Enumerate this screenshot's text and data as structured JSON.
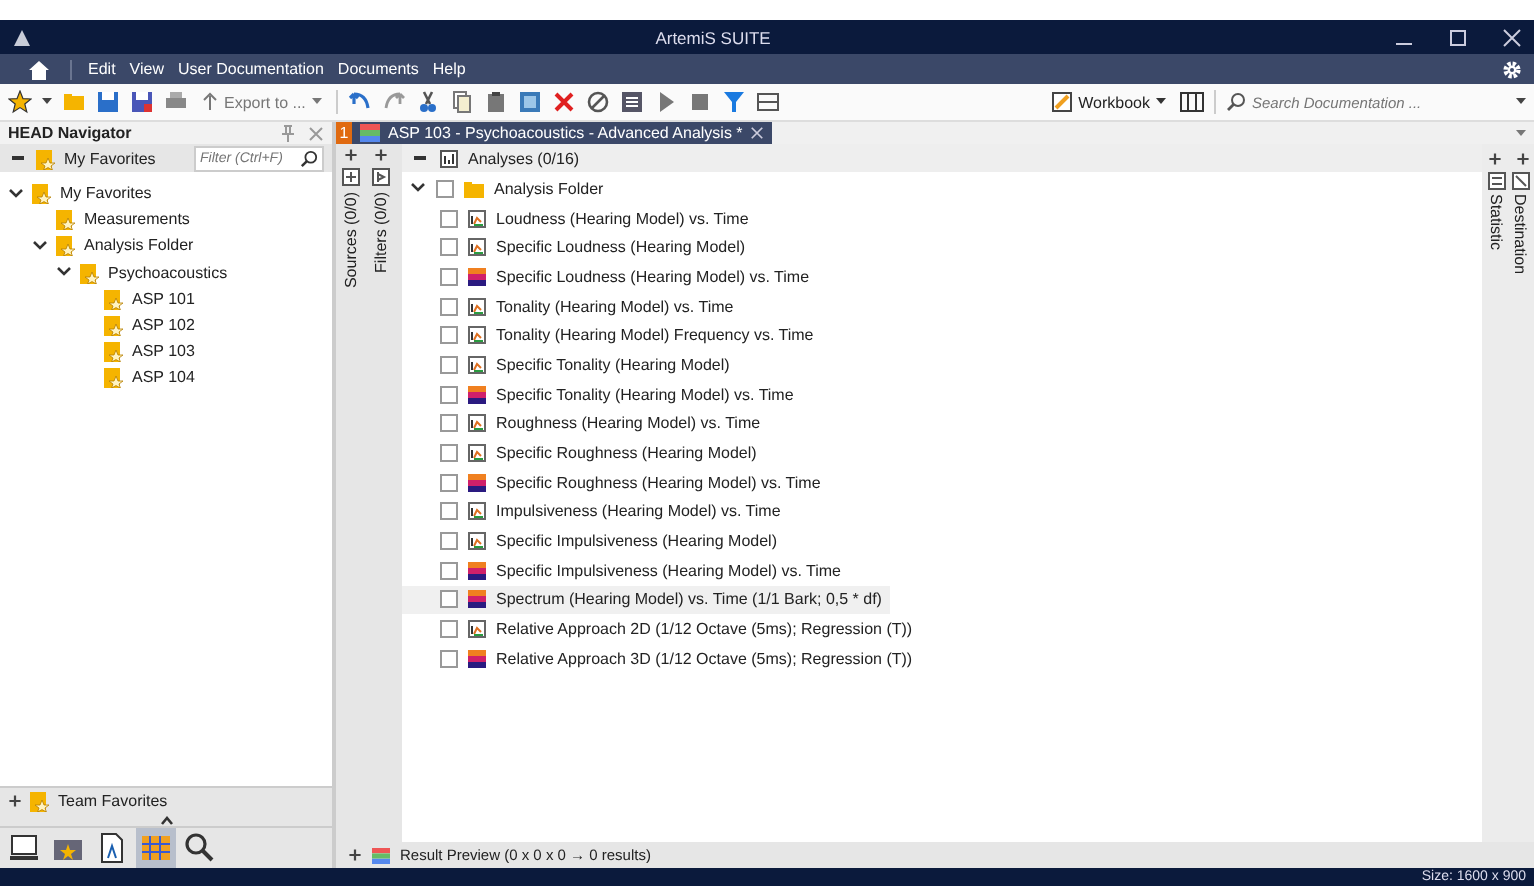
{
  "window": {
    "title": "ArtemiS SUITE"
  },
  "menu": [
    "Edit",
    "View",
    "User Documentation",
    "Documents",
    "Help"
  ],
  "toolbar": {
    "export_label": "Export to ...",
    "workbook_label": "Workbook",
    "search": {
      "placeholder": "Search Documentation ..."
    }
  },
  "navigator": {
    "title": "HEAD Navigator",
    "favorites_label": "My Favorites",
    "filter": {
      "placeholder": "Filter (Ctrl+F)"
    },
    "tree": [
      {
        "label": "My Favorites",
        "expanded": true,
        "children": [
          {
            "label": "Measurements"
          },
          {
            "label": "Analysis Folder",
            "expanded": true,
            "children": [
              {
                "label": "Psychoacoustics",
                "expanded": true,
                "children": [
                  {
                    "label": "ASP 101"
                  },
                  {
                    "label": "ASP 102"
                  },
                  {
                    "label": "ASP 103"
                  },
                  {
                    "label": "ASP 104"
                  }
                ]
              }
            ]
          }
        ]
      }
    ],
    "team_label": "Team Favorites",
    "dock_buttons": [
      {
        "selected": false
      },
      {
        "selected": false
      },
      {
        "selected": false
      },
      {
        "selected": true
      },
      {
        "selected": false
      }
    ]
  },
  "document_tab": {
    "number": "1",
    "title": "ASP 103 - Psychoacoustics - Advanced Analysis *"
  },
  "side_strips": {
    "sources": "Sources (0/0)",
    "filters": "Filters (0/0)",
    "statistic": "Statistic",
    "destination": "Destination"
  },
  "analyses": {
    "header": "Analyses (0/16)",
    "folder": {
      "label": "Analysis Folder",
      "expanded": true,
      "checked": false
    },
    "items": [
      {
        "label": "Loudness (Hearing Model) vs. Time",
        "kind": "curve",
        "checked": false,
        "selected": false
      },
      {
        "label": "Specific Loudness (Hearing Model)",
        "kind": "curve",
        "checked": false,
        "selected": false
      },
      {
        "label": "Specific Loudness (Hearing Model) vs. Time",
        "kind": "map",
        "checked": false,
        "selected": false
      },
      {
        "label": "Tonality (Hearing Model) vs. Time",
        "kind": "curve",
        "checked": false,
        "selected": false
      },
      {
        "label": "Tonality (Hearing Model) Frequency vs. Time",
        "kind": "curve",
        "checked": false,
        "selected": false
      },
      {
        "label": "Specific Tonality (Hearing Model)",
        "kind": "curve",
        "checked": false,
        "selected": false
      },
      {
        "label": "Specific Tonality (Hearing Model) vs. Time",
        "kind": "map",
        "checked": false,
        "selected": false
      },
      {
        "label": "Roughness (Hearing Model) vs. Time",
        "kind": "curve",
        "checked": false,
        "selected": false
      },
      {
        "label": "Specific Roughness (Hearing Model)",
        "kind": "curve",
        "checked": false,
        "selected": false
      },
      {
        "label": "Specific Roughness (Hearing Model) vs. Time",
        "kind": "map",
        "checked": false,
        "selected": false
      },
      {
        "label": "Impulsiveness (Hearing Model) vs. Time",
        "kind": "curve",
        "checked": false,
        "selected": false
      },
      {
        "label": "Specific Impulsiveness (Hearing Model)",
        "kind": "curve",
        "checked": false,
        "selected": false
      },
      {
        "label": "Specific Impulsiveness (Hearing Model) vs. Time",
        "kind": "map",
        "checked": false,
        "selected": false
      },
      {
        "label": "Spectrum (Hearing Model) vs. Time (1/1 Bark; 0,5 * df)",
        "kind": "map",
        "checked": false,
        "selected": true
      },
      {
        "label": "Relative Approach 2D (1/12 Octave (5ms); Regression (T))",
        "kind": "curve",
        "checked": false,
        "selected": false
      },
      {
        "label": "Relative Approach 3D (1/12 Octave (5ms); Regression (T))",
        "kind": "map",
        "checked": false,
        "selected": false
      }
    ]
  },
  "result_preview": "Result Preview (0 x 0 x 0 → 0 results)",
  "status_bar": {
    "size": "Size: 1600 x 900"
  }
}
